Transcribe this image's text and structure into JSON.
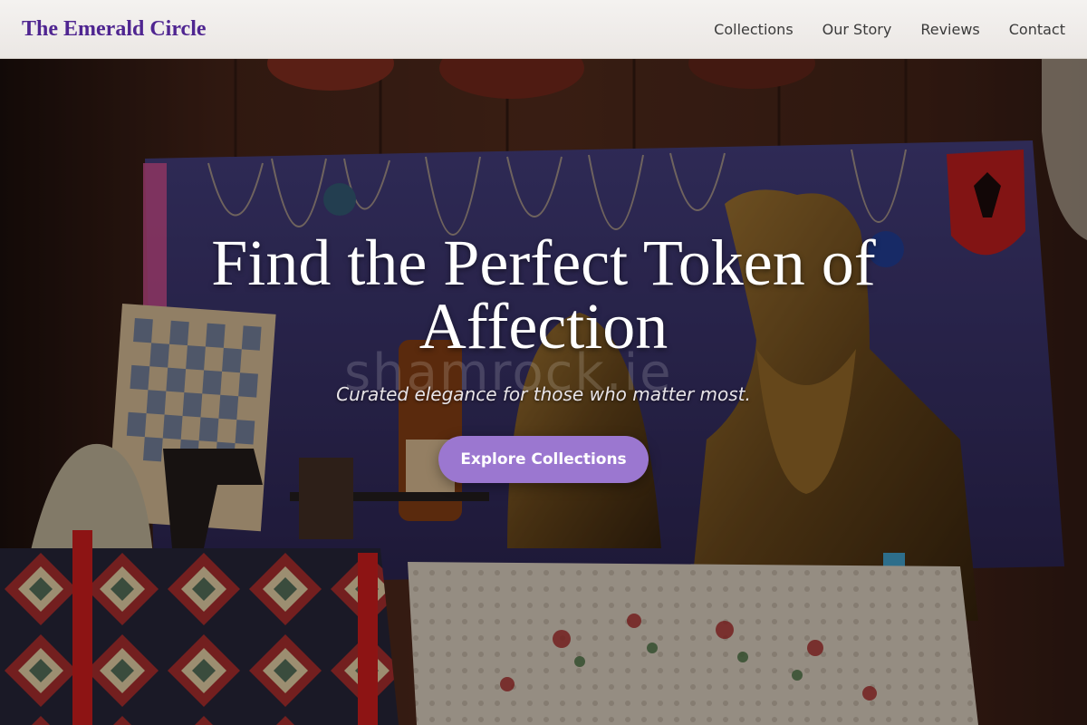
{
  "site": {
    "brand": "The Emerald Circle",
    "nav": [
      "Collections",
      "Our Story",
      "Reviews",
      "Contact"
    ]
  },
  "hero": {
    "title": "Find the Perfect Token of Affection",
    "subtitle": "Curated elegance for those who matter most.",
    "cta_label": "Explore Collections",
    "watermark": "shamrock.ie"
  },
  "colors": {
    "brand": "#4f2591",
    "cta": "#9b77d0",
    "header_bg": "#f0eeec"
  }
}
